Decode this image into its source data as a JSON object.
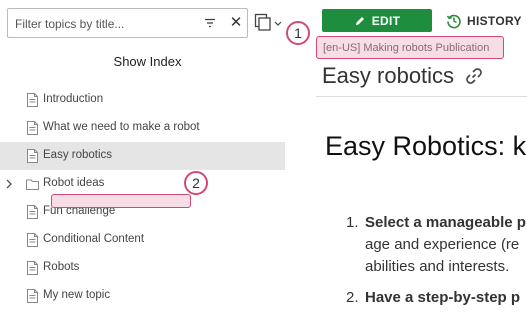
{
  "sidebar": {
    "filter": {
      "placeholder": "Filter topics by title..."
    },
    "show_index_label": "Show Index",
    "topics": [
      {
        "label": "Introduction",
        "type": "document"
      },
      {
        "label": "What we need to make a robot",
        "type": "document"
      },
      {
        "label": "Easy robotics",
        "type": "document",
        "selected": true
      },
      {
        "label": "Robot ideas",
        "type": "folder",
        "expandable": true
      },
      {
        "label": "Fun challenge",
        "type": "document"
      },
      {
        "label": "Conditional Content",
        "type": "document"
      },
      {
        "label": "Robots",
        "type": "document"
      },
      {
        "label": "My new topic",
        "type": "document"
      }
    ]
  },
  "toolbar": {
    "edit_label": "EDIT",
    "history_label": "HISTORY"
  },
  "publication_badge": "[en-US] Making robots Publication",
  "page_title": "Easy robotics",
  "article": {
    "title": "Easy Robotics: ke",
    "list": [
      {
        "num": "1.",
        "bold": "Select a manageable p",
        "rest": [
          "age and experience (re",
          "abilities and interests."
        ]
      },
      {
        "num": "2.",
        "bold": "Have a step-by-step p",
        "rest": []
      }
    ]
  },
  "callouts": {
    "one": "1",
    "two": "2"
  },
  "colors": {
    "edit_green": "#1e8e3e",
    "callout_pink": "#d0497b",
    "callout_fill": "#f6dde6",
    "selected_row": "#e5e5e5"
  }
}
